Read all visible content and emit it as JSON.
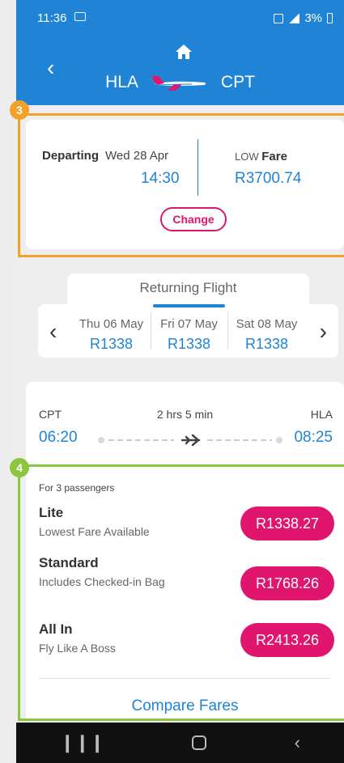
{
  "status": {
    "time": "11:36",
    "battery": "3%"
  },
  "header": {
    "origin": "HLA",
    "destination": "CPT"
  },
  "departing": {
    "label": "Departing",
    "date": "Wed 28 Apr",
    "time": "14:30",
    "fare_low": "LOW",
    "fare_word": "Fare",
    "fare_price": "R3700.74",
    "change_label": "Change"
  },
  "returning": {
    "title": "Returning Flight",
    "dates": [
      {
        "day": "Thu 06 May",
        "price": "R1338"
      },
      {
        "day": "Fri 07 May",
        "price": "R1338"
      },
      {
        "day": "Sat 08 May",
        "price": "R1338"
      }
    ]
  },
  "flight": {
    "from": "CPT",
    "to": "HLA",
    "duration": "2 hrs 5 min",
    "depart_time": "06:20",
    "arrive_time": "08:25"
  },
  "fares": {
    "passengers": "For 3 passengers",
    "options": [
      {
        "name": "Lite",
        "desc": "Lowest Fare Available",
        "price": "R1338.27"
      },
      {
        "name": "Standard",
        "desc": "Includes Checked-in Bag",
        "price": "R1768.26"
      },
      {
        "name": "All In",
        "desc": "Fly Like A Boss",
        "price": "R2413.26"
      }
    ],
    "compare_label": "Compare Fares"
  },
  "annotations": {
    "badge_a": "3",
    "badge_b": "4"
  },
  "colors": {
    "primary": "#1f84d6",
    "accent": "#e0166e",
    "highlight_a": "#f2a12a",
    "highlight_b": "#8cc63f"
  }
}
